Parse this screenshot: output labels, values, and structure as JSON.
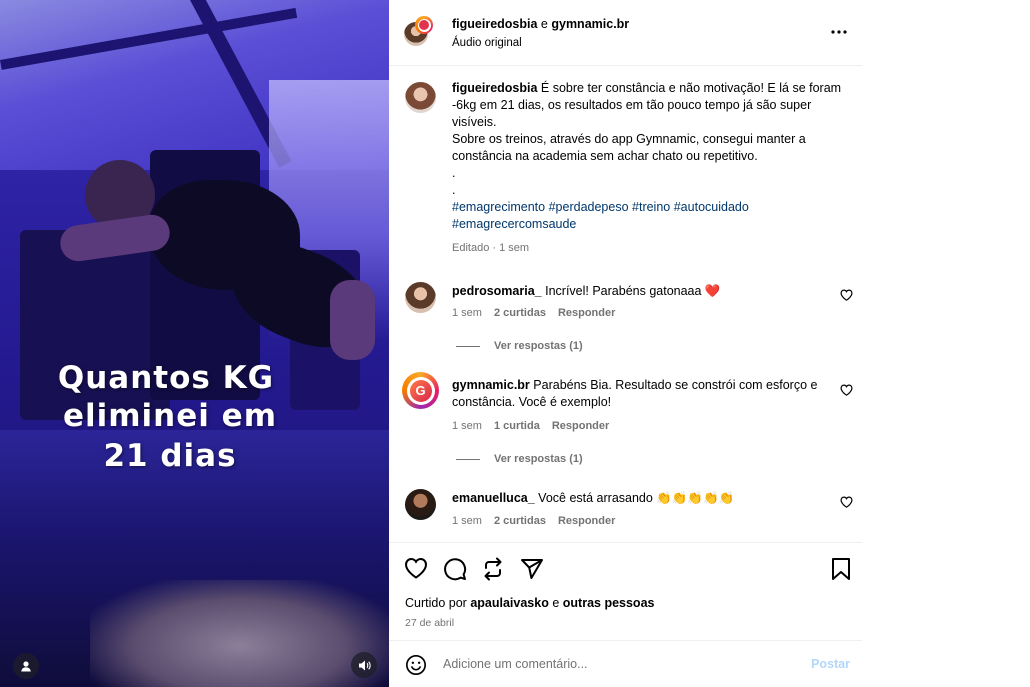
{
  "media": {
    "overlay_lines": [
      "Quantos KG",
      "eliminei em",
      "21 dias"
    ]
  },
  "header": {
    "author": "figueiredosbia",
    "connector": "e",
    "coauthor": "gymnamic.br",
    "audio": "Áudio original"
  },
  "caption": {
    "username": "figueiredosbia",
    "line1": "É sobre ter constância e não motivação! E lá se foram -6kg em 21 dias, os resultados em tão pouco tempo já são super visíveis.",
    "line2": "Sobre os treinos, através do app Gymnamic, consegui manter a constância na academia sem achar chato ou repetitivo.",
    "dot1": ".",
    "dot2": ".",
    "hashtags": [
      "#emagrecimento",
      "#perdadepeso",
      "#treino",
      "#autocuidado",
      "#emagrecercomsaude"
    ],
    "meta": "Editado · 1 sem"
  },
  "comments": [
    {
      "username": "pedrosomaria_",
      "text": "Incrível! Parabéns gatonaaa ❤️",
      "time": "1 sem",
      "likes": "2 curtidas",
      "reply": "Responder",
      "view_replies": "Ver respostas (1)"
    },
    {
      "username": "gymnamic.br",
      "text": "Parabéns Bia. Resultado se constrói com esforço e constância. Você é exemplo!",
      "time": "1 sem",
      "likes": "1 curtida",
      "reply": "Responder",
      "view_replies": "Ver respostas (1)"
    },
    {
      "username": "emanuelluca_",
      "text": "Você está arrasando 👏👏👏👏👏",
      "time": "1 sem",
      "likes": "2 curtidas",
      "reply": "Responder"
    }
  ],
  "actions": {
    "liked_prefix": "Curtido por",
    "liked_user": "apaulaivasko",
    "liked_connector": "e",
    "liked_others": "outras pessoas",
    "date": "27 de abril"
  },
  "comment_input": {
    "placeholder": "Adicione um comentário...",
    "post_label": "Postar"
  },
  "icons": {
    "more": "more-options-icon",
    "like": "heart-icon",
    "comment": "comment-icon",
    "repost": "repost-icon",
    "share": "share-icon",
    "save": "bookmark-icon",
    "emoji": "emoji-icon",
    "user": "user-tag-icon",
    "audio": "speaker-icon"
  }
}
